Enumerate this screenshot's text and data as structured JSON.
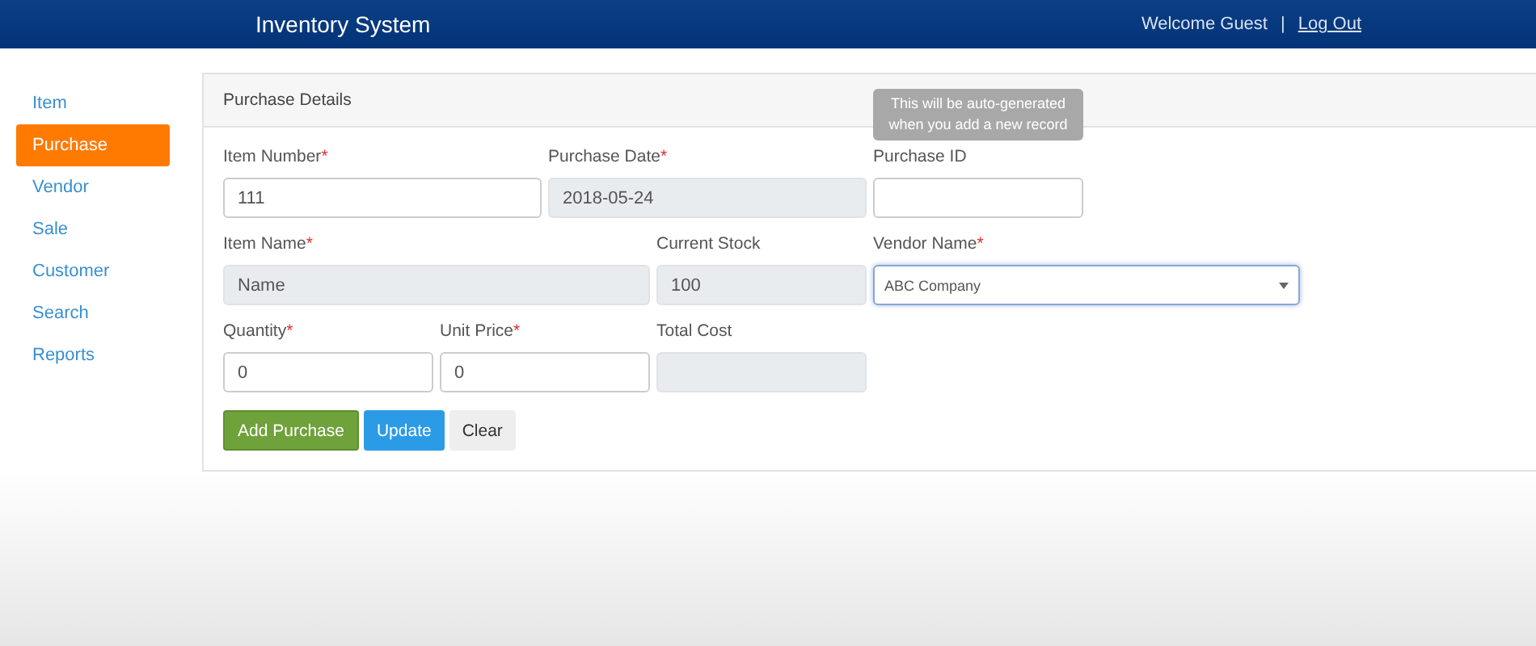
{
  "header": {
    "title": "Inventory System",
    "welcome": "Welcome Guest",
    "separator": "|",
    "logout": "Log Out"
  },
  "sidebar": {
    "items": [
      {
        "label": "Item",
        "selected": false
      },
      {
        "label": "Purchase",
        "selected": true
      },
      {
        "label": "Vendor",
        "selected": false
      },
      {
        "label": "Sale",
        "selected": false
      },
      {
        "label": "Customer",
        "selected": false
      },
      {
        "label": "Search",
        "selected": false
      },
      {
        "label": "Reports",
        "selected": false
      }
    ]
  },
  "panel": {
    "title": "Purchase Details",
    "rows": [
      [
        {
          "label": "Item Number",
          "mark": "*",
          "kind": "text",
          "value": "111",
          "disabled": false
        },
        {
          "label": "Purchase Date",
          "mark": "*",
          "kind": "text",
          "value": "2018-05-24",
          "disabled": true
        },
        {
          "label": "Purchase ID",
          "kind": "text",
          "disabled": false,
          "tooltip": "This will be auto-generated when you add a new record"
        }
      ],
      [
        {
          "label": "Item Name",
          "mark": "*",
          "kind": "text",
          "value": "Name",
          "disabled": true
        },
        {
          "label": "Current Stock",
          "kind": "text",
          "value": "100",
          "disabled": true
        },
        {
          "label": "Vendor Name",
          "mark": "*",
          "kind": "select",
          "value": "ABC Company",
          "disabled": false
        }
      ],
      [
        {
          "label": "Quantity",
          "mark": "*",
          "kind": "text",
          "value": "0",
          "disabled": false
        },
        {
          "label": "Unit Price",
          "mark": "*",
          "kind": "text",
          "value": "0",
          "disabled": false
        },
        {
          "label": "Total Cost",
          "kind": "text",
          "disabled": true
        }
      ]
    ],
    "buttons": [
      {
        "label": "Add Purchase",
        "kind": "success"
      },
      {
        "label": "Update",
        "kind": "primary"
      },
      {
        "label": "Clear",
        "kind": "default"
      }
    ]
  }
}
